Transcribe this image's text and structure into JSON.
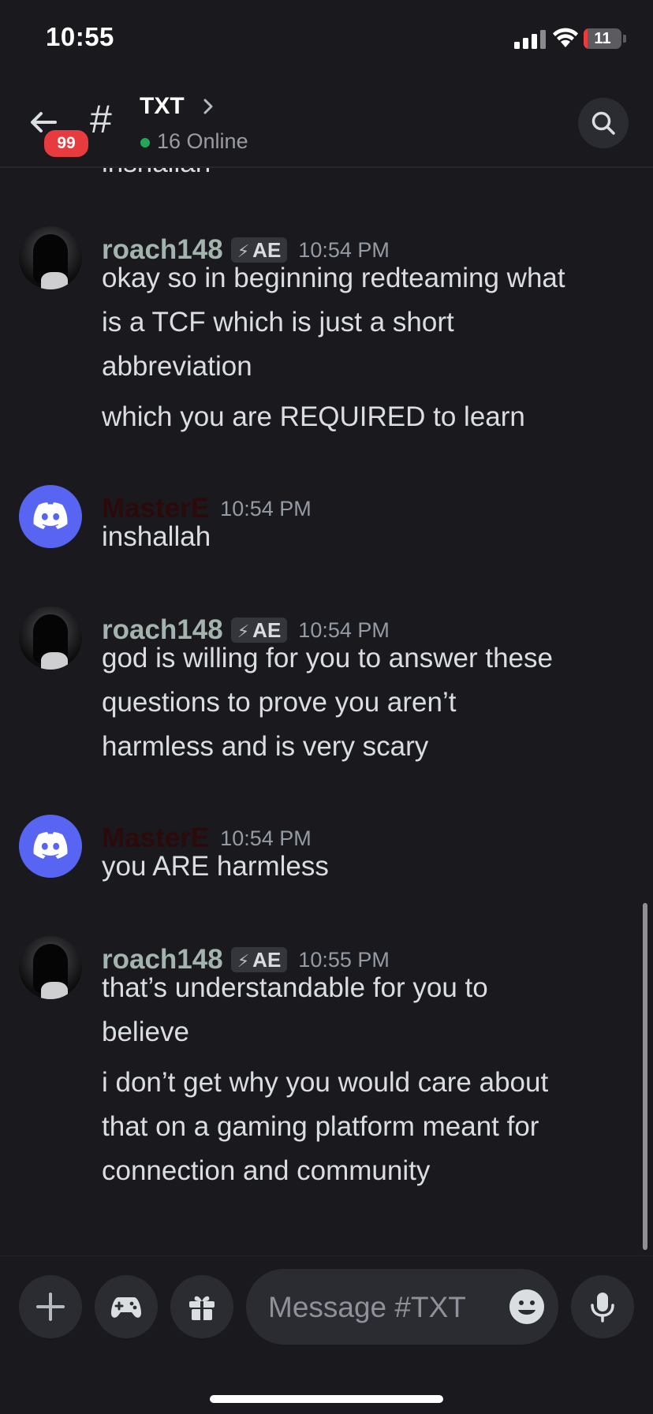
{
  "status_bar": {
    "time": "10:55",
    "battery": "11",
    "battery_level": 0.11
  },
  "header": {
    "mention_count": "99",
    "channel_name": "TXT",
    "online_text": "16 Online"
  },
  "colors": {
    "accent": "#5865f2",
    "online": "#23a55a",
    "badge": "#e83b3f",
    "roach_name": "#a3b3ad",
    "mastere_name": "#2a0a0a"
  },
  "messages": {
    "cut_off_text": "inshallah",
    "items": [
      {
        "author": "roach148",
        "tag": "AE",
        "time": "10:54 PM",
        "avatar": "hooded-figure-avatar",
        "lines": [
          "okay so in beginning redteaming what",
          "is a TCF which is just a short",
          "abbreviation",
          "which you are REQUIRED to learn"
        ]
      },
      {
        "author": "MasterE",
        "tag": "",
        "time": "10:54 PM",
        "avatar": "discord-logo-avatar",
        "lines": [
          "inshallah"
        ]
      },
      {
        "author": "roach148",
        "tag": "AE",
        "time": "10:54 PM",
        "avatar": "hooded-figure-avatar",
        "lines": [
          "god is willing for you to answer these",
          "questions to prove you aren’t",
          "harmless and is very scary"
        ]
      },
      {
        "author": "MasterE",
        "tag": "",
        "time": "10:54 PM",
        "avatar": "discord-logo-avatar",
        "lines": [
          "you ARE harmless"
        ]
      },
      {
        "author": "roach148",
        "tag": "AE",
        "time": "10:55 PM",
        "avatar": "hooded-figure-avatar",
        "lines": [
          "that’s understandable for you to",
          "believe",
          "i don’t get why you would care about",
          "that on a gaming platform meant for",
          "connection and community"
        ]
      }
    ]
  },
  "composer": {
    "placeholder": "Message #TXT"
  },
  "icons": [
    "back-arrow-icon",
    "hash-icon",
    "chevron-right-icon",
    "search-icon",
    "plus-icon",
    "gamepad-icon",
    "gift-icon",
    "emoji-icon",
    "microphone-icon"
  ]
}
